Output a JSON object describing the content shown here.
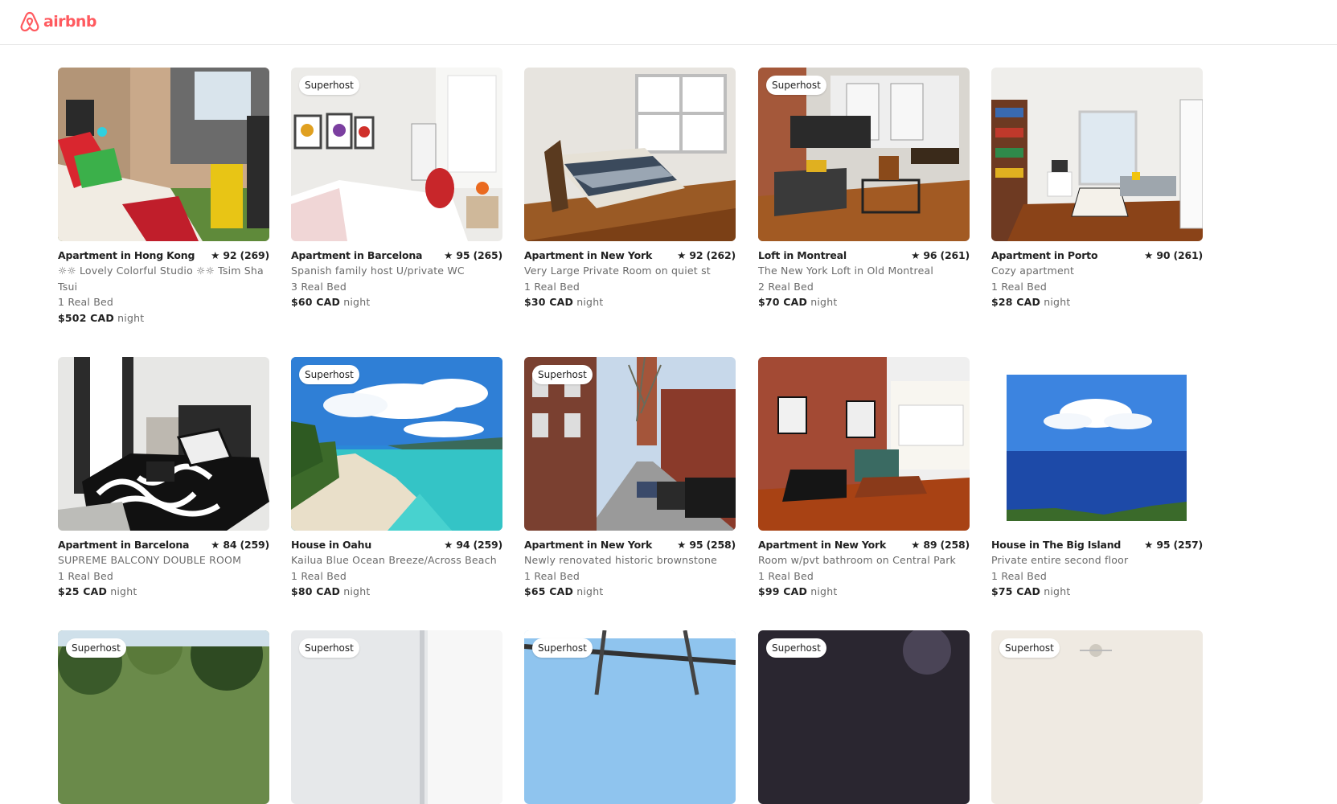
{
  "brand": {
    "name": "airbnb",
    "color": "#ff5a5f"
  },
  "badge_label": "Superhost",
  "listings": [
    {
      "type": "Apartment in Hong Kong",
      "rating": "★ 92 (269)",
      "desc": "☼☼ Lovely Colorful Studio ☼☼ Tsim Sha Tsui",
      "beds": "1 Real Bed",
      "price": "$502 CAD",
      "unit": "night",
      "superhost": false,
      "scene": "bedroom-red"
    },
    {
      "type": "Apartment in Barcelona",
      "rating": "★ 95 (265)",
      "desc": "Spanish family host U/private WC",
      "beds": "3 Real Bed",
      "price": "$60 CAD",
      "unit": "night",
      "superhost": true,
      "scene": "bedroom-white"
    },
    {
      "type": "Apartment in New York",
      "rating": "★ 92 (262)",
      "desc": "Very Large Private Room on quiet st",
      "beds": "1 Real Bed",
      "price": "$30 CAD",
      "unit": "night",
      "superhost": false,
      "scene": "bedroom-wood"
    },
    {
      "type": "Loft in Montreal",
      "rating": "★ 96 (261)",
      "desc": "The New York Loft in Old Montreal",
      "beds": "2 Real Bed",
      "price": "$70 CAD",
      "unit": "night",
      "superhost": true,
      "scene": "loft"
    },
    {
      "type": "Apartment in Porto",
      "rating": "★ 90 (261)",
      "desc": "Cozy apartment",
      "beds": "1 Real Bed",
      "price": "$28 CAD",
      "unit": "night",
      "superhost": false,
      "scene": "living-bright"
    },
    {
      "type": "Apartment in Barcelona",
      "rating": "★ 84 (259)",
      "desc": "SUPREME BALCONY DOUBLE ROOM",
      "beds": "1 Real Bed",
      "price": "$25 CAD",
      "unit": "night",
      "superhost": false,
      "scene": "bedroom-bw"
    },
    {
      "type": "House in Oahu",
      "rating": "★ 94 (259)",
      "desc": "Kailua Blue Ocean Breeze/Across Beach",
      "beds": "1 Real Bed",
      "price": "$80 CAD",
      "unit": "night",
      "superhost": true,
      "scene": "beach"
    },
    {
      "type": "Apartment in New York",
      "rating": "★ 95 (258)",
      "desc": "Newly renovated historic brownstone",
      "beds": "1 Real Bed",
      "price": "$65 CAD",
      "unit": "night",
      "superhost": true,
      "scene": "street"
    },
    {
      "type": "Apartment in New York",
      "rating": "★ 89 (258)",
      "desc": "Room w/pvt bathroom on Central Park",
      "beds": "1 Real Bed",
      "price": "$99 CAD",
      "unit": "night",
      "superhost": false,
      "scene": "brick-living"
    },
    {
      "type": "House in The Big Island",
      "rating": "★ 95 (257)",
      "desc": "Private entire second floor",
      "beds": "1 Real Bed",
      "price": "$75 CAD",
      "unit": "night",
      "superhost": false,
      "scene": "ocean-view"
    },
    {
      "superhost": true,
      "scene": "trees"
    },
    {
      "superhost": true,
      "scene": "white-bath"
    },
    {
      "superhost": true,
      "scene": "pergola"
    },
    {
      "superhost": true,
      "scene": "night"
    },
    {
      "superhost": true,
      "scene": "ceiling"
    }
  ]
}
